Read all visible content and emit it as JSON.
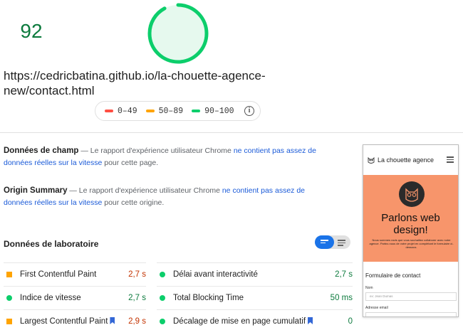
{
  "score": {
    "value": "92",
    "ring_fraction": 0.92,
    "color": "#0cce6b"
  },
  "url": {
    "text": "https://cedricbatina.github.io/la-chouette-agence-new/contact.html"
  },
  "legend": {
    "items": [
      {
        "label": "0–49",
        "color": "#ff4e42"
      },
      {
        "label": "50–89",
        "color": "#ffa400"
      },
      {
        "label": "90–100",
        "color": "#0cce6b"
      }
    ],
    "info_icon": "info-icon"
  },
  "field_data": {
    "title": "Données de champ",
    "text_before": " — Le rapport d'expérience utilisateur Chrome ",
    "link": "ne contient pas assez de données réelles sur la vitesse",
    "text_after": " pour cette page."
  },
  "origin_summary": {
    "title": "Origin Summary",
    "text_before": " — Le rapport d'expérience utilisateur Chrome ",
    "link": "ne contient pas assez de données réelles sur la vitesse",
    "text_after": " pour cette origine."
  },
  "lab": {
    "title": "Données de laboratoire",
    "metrics_left": [
      {
        "label": "First Contentful Paint",
        "value": "2,7 s",
        "status": "average",
        "shape": "square",
        "color": "#ffa400",
        "value_color": "#c33300",
        "bookmark": false
      },
      {
        "label": "Indice de vitesse",
        "value": "2,7 s",
        "status": "pass",
        "shape": "circle",
        "color": "#0cce6b",
        "value_color": "#0c7a3d",
        "bookmark": false
      },
      {
        "label": "Largest Contentful Paint",
        "value": "2,9 s",
        "status": "average",
        "shape": "square",
        "color": "#ffa400",
        "value_color": "#c33300",
        "bookmark": true
      }
    ],
    "metrics_right": [
      {
        "label": "Délai avant interactivité",
        "value": "2,7 s",
        "status": "pass",
        "shape": "circle",
        "color": "#0cce6b",
        "value_color": "#0c7a3d",
        "bookmark": false
      },
      {
        "label": "Total Blocking Time",
        "value": "50 ms",
        "status": "pass",
        "shape": "circle",
        "color": "#0cce6b",
        "value_color": "#0c7a3d",
        "bookmark": false
      },
      {
        "label": "Décalage de mise en page cumulatif",
        "value": "0",
        "status": "pass",
        "shape": "circle",
        "color": "#0cce6b",
        "value_color": "#0c7a3d",
        "bookmark": true
      }
    ]
  },
  "screenshot": {
    "brand": "La chouette agence",
    "hero_title": "Parlons web design!",
    "hero_text": "Nous sommes ravis que vous souhaitiez collaborer avec notre agence. Parlez-nous de votre projet en complétant le formulaire ci-dessous.",
    "form_title": "Formulaire de contact",
    "field_name_label": "Nom",
    "field_name_placeholder": "ex: Jean Dumas",
    "field_email_label": "Adresse email",
    "hero_color": "#f7956b"
  }
}
